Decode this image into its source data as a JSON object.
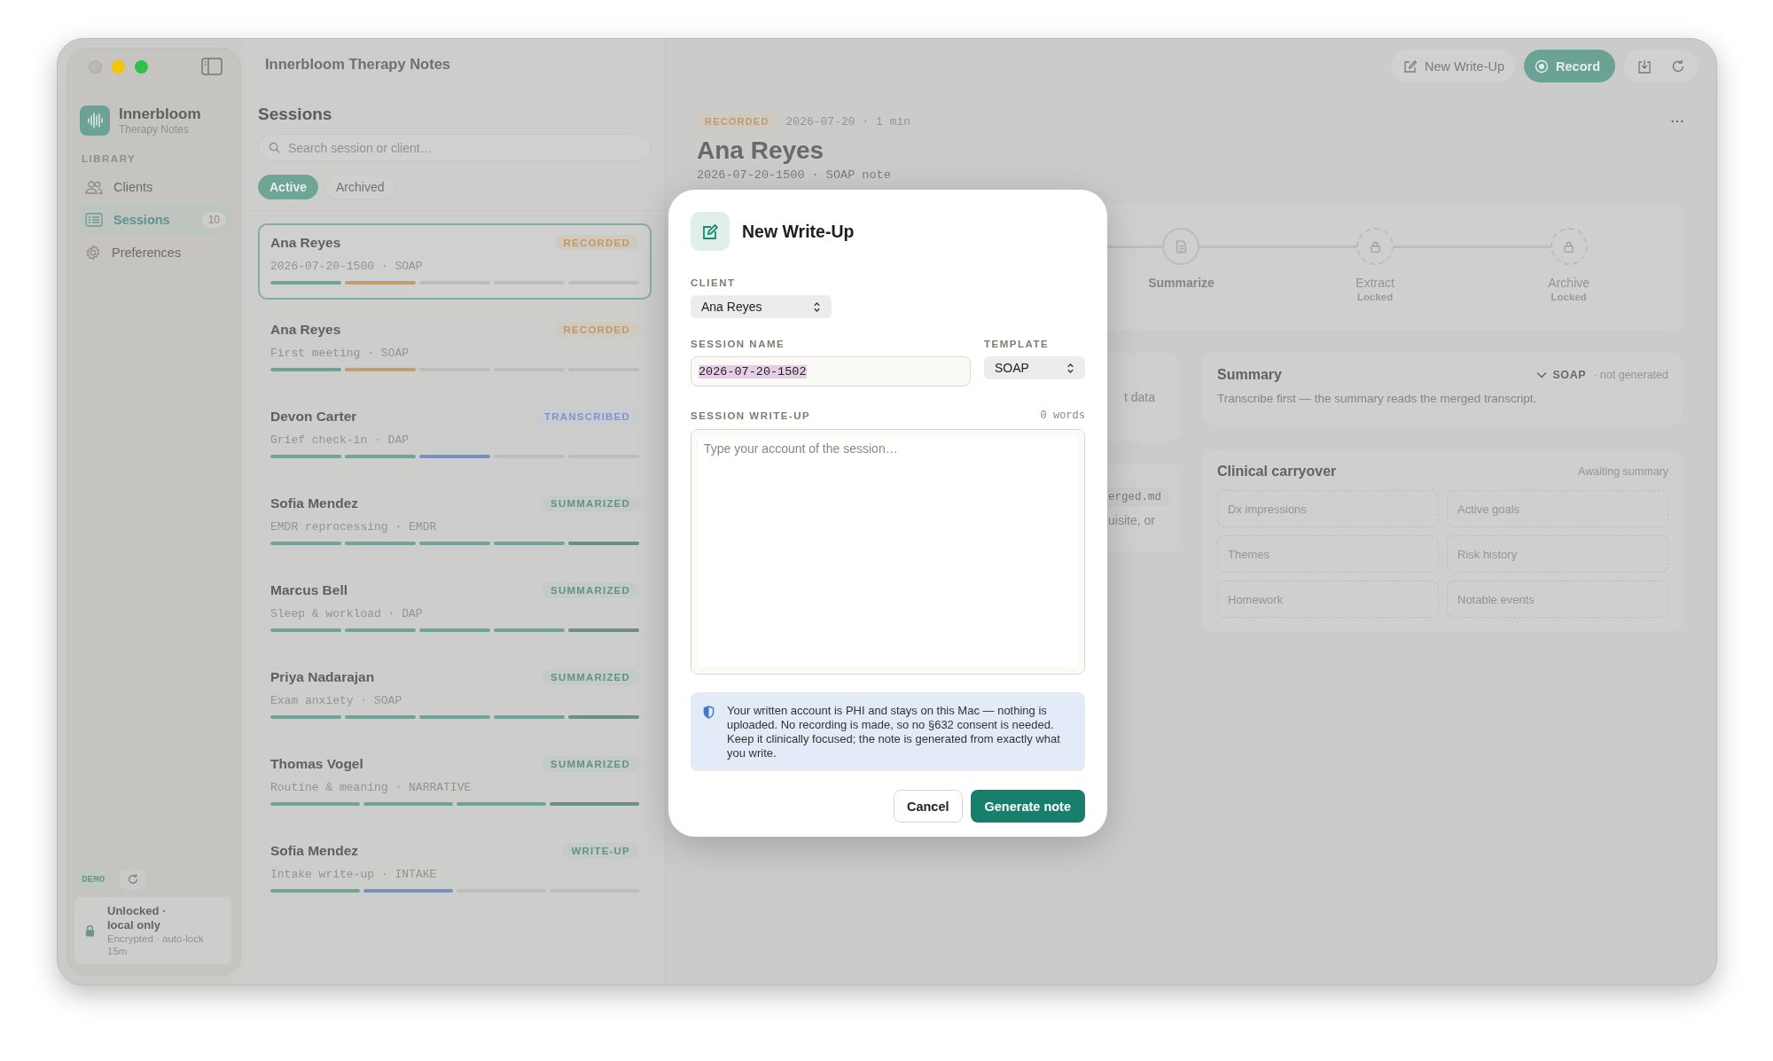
{
  "window": {
    "title": "Innerbloom Therapy Notes"
  },
  "sidebar": {
    "app_name": "Innerbloom",
    "app_subtitle": "Therapy Notes",
    "section": "LIBRARY",
    "items": [
      {
        "label": "Clients",
        "kind": "clients",
        "selected": false
      },
      {
        "label": "Sessions",
        "kind": "sessions",
        "count": "10",
        "selected": true
      },
      {
        "label": "Preferences",
        "kind": "preferences",
        "selected": false
      }
    ],
    "demo_badge": "DEMO",
    "lock": {
      "title": "Unlocked · local only",
      "detail": "Encrypted · auto-lock 15m"
    }
  },
  "sessions": {
    "title": "Sessions",
    "search": {
      "placeholder": "Search session or client…"
    },
    "tabs": [
      {
        "label": "Active",
        "selected": true
      },
      {
        "label": "Archived",
        "selected": false
      }
    ],
    "items": [
      {
        "name": "Ana Reyes",
        "subtitle": "2026-07-20-1500 · SOAP",
        "status": {
          "label": "RECORDED",
          "kind": "recorded"
        },
        "selected": true,
        "segments": [
          {
            "color": "#6ea597"
          },
          {
            "color": "#bf9f6e"
          },
          {
            "color": "#bdbdbc"
          },
          {
            "color": "#bdbdbc"
          },
          {
            "color": "#bdbdbc"
          }
        ]
      },
      {
        "name": "Ana Reyes",
        "subtitle": "First meeting · SOAP",
        "status": {
          "label": "RECORDED",
          "kind": "recorded"
        },
        "selected": false,
        "segments": [
          {
            "color": "#6ea597"
          },
          {
            "color": "#bf9f6e"
          },
          {
            "color": "#bdbdbc"
          },
          {
            "color": "#bdbdbc"
          },
          {
            "color": "#bdbdbc"
          }
        ]
      },
      {
        "name": "Devon Carter",
        "subtitle": "Grief check-in · DAP",
        "status": {
          "label": "TRANSCRIBED",
          "kind": "transcribed"
        },
        "selected": false,
        "segments": [
          {
            "color": "#6ea597"
          },
          {
            "color": "#6ea597"
          },
          {
            "color": "#7890c0"
          },
          {
            "color": "#bdbdbc"
          },
          {
            "color": "#bdbdbc"
          }
        ]
      },
      {
        "name": "Sofia Mendez",
        "subtitle": "EMDR reprocessing · EMDR",
        "status": {
          "label": "SUMMARIZED",
          "kind": "summarized"
        },
        "selected": false,
        "segments": [
          {
            "color": "#6ea597"
          },
          {
            "color": "#6ea597"
          },
          {
            "color": "#6ea597"
          },
          {
            "color": "#6ea597"
          },
          {
            "color": "#6c8e84"
          }
        ]
      },
      {
        "name": "Marcus Bell",
        "subtitle": "Sleep & workload · DAP",
        "status": {
          "label": "SUMMARIZED",
          "kind": "summarized"
        },
        "selected": false,
        "segments": [
          {
            "color": "#6ea597"
          },
          {
            "color": "#6ea597"
          },
          {
            "color": "#6ea597"
          },
          {
            "color": "#6ea597"
          },
          {
            "color": "#6c8e84"
          }
        ]
      },
      {
        "name": "Priya Nadarajan",
        "subtitle": "Exam anxiety · SOAP",
        "status": {
          "label": "SUMMARIZED",
          "kind": "summarized"
        },
        "selected": false,
        "segments": [
          {
            "color": "#6ea597"
          },
          {
            "color": "#6ea597"
          },
          {
            "color": "#6ea597"
          },
          {
            "color": "#6ea597"
          },
          {
            "color": "#6c8e84"
          }
        ]
      },
      {
        "name": "Thomas Vogel",
        "subtitle": "Routine & meaning · NARRATIVE",
        "status": {
          "label": "SUMMARIZED",
          "kind": "summarized"
        },
        "selected": false,
        "segments": [
          {
            "color": "#6ea597"
          },
          {
            "color": "#6ea597"
          },
          {
            "color": "#6ea597"
          },
          {
            "color": "#6c8e84"
          }
        ]
      },
      {
        "name": "Sofia Mendez",
        "subtitle": "Intake write-up · INTAKE",
        "status": {
          "label": "WRITE-UP",
          "kind": "writeup"
        },
        "selected": false,
        "segments": [
          {
            "color": "#6ea597"
          },
          {
            "color": "#7890c0"
          },
          {
            "color": "#bdbdbc"
          },
          {
            "color": "#bdbdbc"
          }
        ]
      }
    ]
  },
  "toolbar": {
    "buttons": [
      {
        "label": "New Write-Up",
        "kind": "secondary"
      },
      {
        "label": "Record",
        "kind": "primary"
      }
    ]
  },
  "detail": {
    "status": {
      "label": "RECORDED",
      "kind": "recorded"
    },
    "meta": "2026-07-20 · 1 min",
    "title": "Ana Reyes",
    "subtitle": "2026-07-20-1500 · SOAP note",
    "pipeline": [
      {
        "label": "Summarize",
        "locked": false
      },
      {
        "label": "Extract",
        "locked": true,
        "note": "Locked"
      },
      {
        "label": "Archive",
        "locked": true,
        "note": "Locked"
      }
    ],
    "partial_cards": [
      {
        "text": "t data"
      },
      {
        "code": "erged.md",
        "text": "uisite, or"
      }
    ],
    "summary": {
      "title": "Summary",
      "template": "SOAP",
      "status": "· not generated",
      "body": "Transcribe first — the summary reads the merged transcript."
    },
    "carryover": {
      "title": "Clinical carryover",
      "status": "Awaiting summary",
      "slots": [
        "Dx impressions",
        "Active goals",
        "Themes",
        "Risk history",
        "Homework",
        "Notable events"
      ]
    }
  },
  "modal": {
    "title": "New Write-Up",
    "client": {
      "label": "CLIENT",
      "value": "Ana Reyes"
    },
    "session_name": {
      "label": "SESSION NAME",
      "value": "2026-07-20-1502"
    },
    "template": {
      "label": "TEMPLATE",
      "value": "SOAP"
    },
    "write_up": {
      "label": "SESSION WRITE-UP",
      "word_count": "0 words",
      "placeholder": "Type your account of the session…"
    },
    "notice": "Your written account is PHI and stays on this Mac — nothing is uploaded. No recording is made, so no §632 consent is needed. Keep it clinically focused; the note is generated from exactly what you write.",
    "buttons": [
      {
        "label": "Cancel",
        "kind": "secondary"
      },
      {
        "label": "Generate note",
        "kind": "primary"
      }
    ]
  }
}
